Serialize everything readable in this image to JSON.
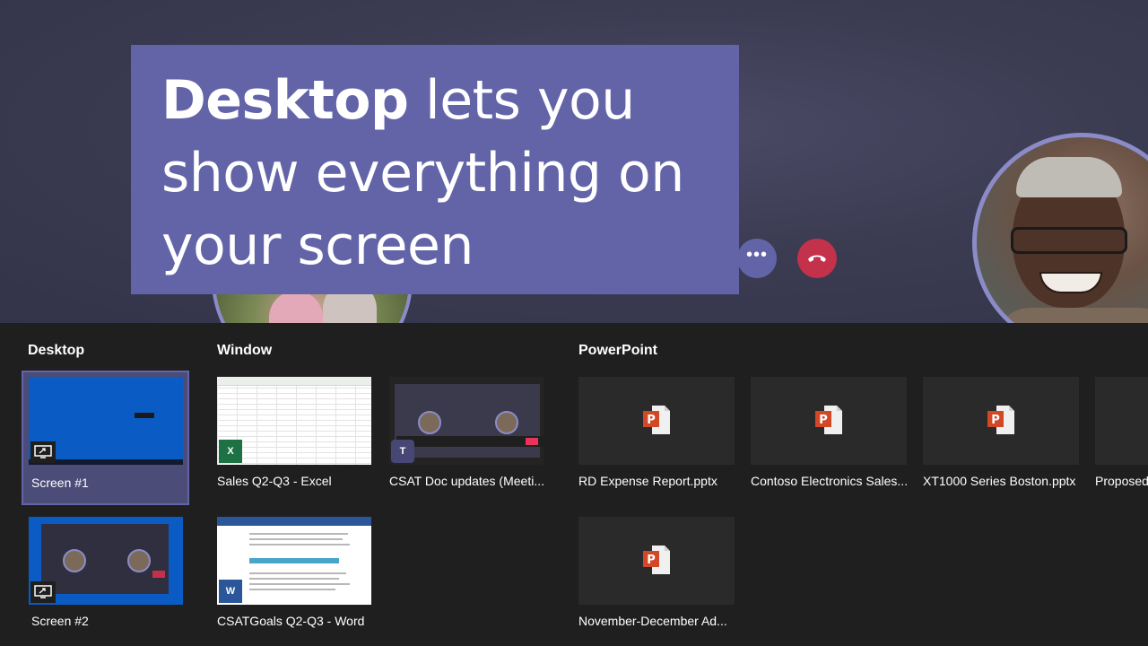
{
  "headline": {
    "bold": "Desktop",
    "line1_rest": " lets you",
    "line2": "show everything on",
    "line3": "your screen"
  },
  "controls": {
    "more_label": "•••"
  },
  "sections": {
    "desktop": "Desktop",
    "window": "Window",
    "powerpoint": "PowerPoint"
  },
  "desktop_tiles": [
    {
      "label": "Screen #1",
      "selected": true
    },
    {
      "label": "Screen #2",
      "selected": false
    }
  ],
  "window_tiles": [
    {
      "label": "Sales Q2-Q3 - Excel",
      "app": "excel",
      "badge": "X"
    },
    {
      "label": "CSAT Doc updates (Meeti...",
      "app": "teams",
      "badge": "T"
    },
    {
      "label": "CSATGoals Q2-Q3 - Word",
      "app": "word",
      "badge": "W"
    }
  ],
  "powerpoint_tiles": [
    {
      "label": "RD Expense Report.pptx"
    },
    {
      "label": "Contoso Electronics Sales..."
    },
    {
      "label": "XT1000 Series Boston.pptx"
    },
    {
      "label": "Proposed"
    },
    {
      "label": "November-December Ad..."
    }
  ],
  "colors": {
    "accent": "#6264a7",
    "hangup": "#c4314b",
    "tray_bg": "#201f1f",
    "ppt_orange": "#d24726"
  }
}
